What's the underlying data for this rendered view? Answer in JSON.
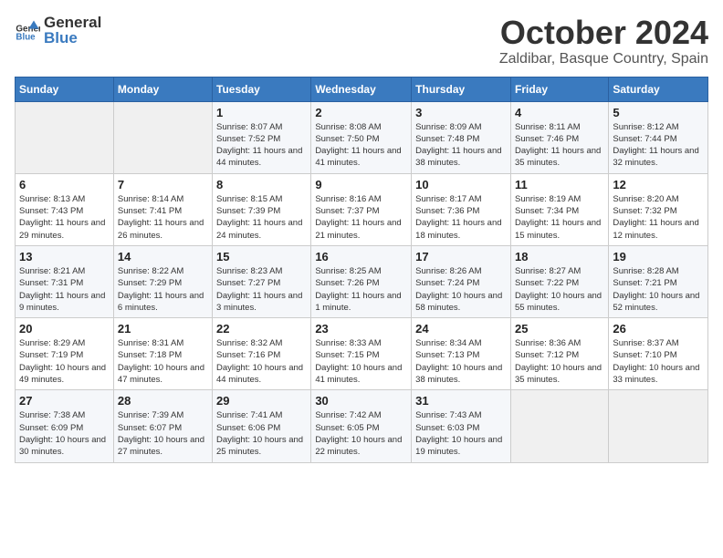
{
  "header": {
    "logo_general": "General",
    "logo_blue": "Blue",
    "month": "October 2024",
    "location": "Zaldibar, Basque Country, Spain"
  },
  "days_of_week": [
    "Sunday",
    "Monday",
    "Tuesday",
    "Wednesday",
    "Thursday",
    "Friday",
    "Saturday"
  ],
  "weeks": [
    [
      {
        "day": "",
        "info": ""
      },
      {
        "day": "",
        "info": ""
      },
      {
        "day": "1",
        "info": "Sunrise: 8:07 AM\nSunset: 7:52 PM\nDaylight: 11 hours and 44 minutes."
      },
      {
        "day": "2",
        "info": "Sunrise: 8:08 AM\nSunset: 7:50 PM\nDaylight: 11 hours and 41 minutes."
      },
      {
        "day": "3",
        "info": "Sunrise: 8:09 AM\nSunset: 7:48 PM\nDaylight: 11 hours and 38 minutes."
      },
      {
        "day": "4",
        "info": "Sunrise: 8:11 AM\nSunset: 7:46 PM\nDaylight: 11 hours and 35 minutes."
      },
      {
        "day": "5",
        "info": "Sunrise: 8:12 AM\nSunset: 7:44 PM\nDaylight: 11 hours and 32 minutes."
      }
    ],
    [
      {
        "day": "6",
        "info": "Sunrise: 8:13 AM\nSunset: 7:43 PM\nDaylight: 11 hours and 29 minutes."
      },
      {
        "day": "7",
        "info": "Sunrise: 8:14 AM\nSunset: 7:41 PM\nDaylight: 11 hours and 26 minutes."
      },
      {
        "day": "8",
        "info": "Sunrise: 8:15 AM\nSunset: 7:39 PM\nDaylight: 11 hours and 24 minutes."
      },
      {
        "day": "9",
        "info": "Sunrise: 8:16 AM\nSunset: 7:37 PM\nDaylight: 11 hours and 21 minutes."
      },
      {
        "day": "10",
        "info": "Sunrise: 8:17 AM\nSunset: 7:36 PM\nDaylight: 11 hours and 18 minutes."
      },
      {
        "day": "11",
        "info": "Sunrise: 8:19 AM\nSunset: 7:34 PM\nDaylight: 11 hours and 15 minutes."
      },
      {
        "day": "12",
        "info": "Sunrise: 8:20 AM\nSunset: 7:32 PM\nDaylight: 11 hours and 12 minutes."
      }
    ],
    [
      {
        "day": "13",
        "info": "Sunrise: 8:21 AM\nSunset: 7:31 PM\nDaylight: 11 hours and 9 minutes."
      },
      {
        "day": "14",
        "info": "Sunrise: 8:22 AM\nSunset: 7:29 PM\nDaylight: 11 hours and 6 minutes."
      },
      {
        "day": "15",
        "info": "Sunrise: 8:23 AM\nSunset: 7:27 PM\nDaylight: 11 hours and 3 minutes."
      },
      {
        "day": "16",
        "info": "Sunrise: 8:25 AM\nSunset: 7:26 PM\nDaylight: 11 hours and 1 minute."
      },
      {
        "day": "17",
        "info": "Sunrise: 8:26 AM\nSunset: 7:24 PM\nDaylight: 10 hours and 58 minutes."
      },
      {
        "day": "18",
        "info": "Sunrise: 8:27 AM\nSunset: 7:22 PM\nDaylight: 10 hours and 55 minutes."
      },
      {
        "day": "19",
        "info": "Sunrise: 8:28 AM\nSunset: 7:21 PM\nDaylight: 10 hours and 52 minutes."
      }
    ],
    [
      {
        "day": "20",
        "info": "Sunrise: 8:29 AM\nSunset: 7:19 PM\nDaylight: 10 hours and 49 minutes."
      },
      {
        "day": "21",
        "info": "Sunrise: 8:31 AM\nSunset: 7:18 PM\nDaylight: 10 hours and 47 minutes."
      },
      {
        "day": "22",
        "info": "Sunrise: 8:32 AM\nSunset: 7:16 PM\nDaylight: 10 hours and 44 minutes."
      },
      {
        "day": "23",
        "info": "Sunrise: 8:33 AM\nSunset: 7:15 PM\nDaylight: 10 hours and 41 minutes."
      },
      {
        "day": "24",
        "info": "Sunrise: 8:34 AM\nSunset: 7:13 PM\nDaylight: 10 hours and 38 minutes."
      },
      {
        "day": "25",
        "info": "Sunrise: 8:36 AM\nSunset: 7:12 PM\nDaylight: 10 hours and 35 minutes."
      },
      {
        "day": "26",
        "info": "Sunrise: 8:37 AM\nSunset: 7:10 PM\nDaylight: 10 hours and 33 minutes."
      }
    ],
    [
      {
        "day": "27",
        "info": "Sunrise: 7:38 AM\nSunset: 6:09 PM\nDaylight: 10 hours and 30 minutes."
      },
      {
        "day": "28",
        "info": "Sunrise: 7:39 AM\nSunset: 6:07 PM\nDaylight: 10 hours and 27 minutes."
      },
      {
        "day": "29",
        "info": "Sunrise: 7:41 AM\nSunset: 6:06 PM\nDaylight: 10 hours and 25 minutes."
      },
      {
        "day": "30",
        "info": "Sunrise: 7:42 AM\nSunset: 6:05 PM\nDaylight: 10 hours and 22 minutes."
      },
      {
        "day": "31",
        "info": "Sunrise: 7:43 AM\nSunset: 6:03 PM\nDaylight: 10 hours and 19 minutes."
      },
      {
        "day": "",
        "info": ""
      },
      {
        "day": "",
        "info": ""
      }
    ]
  ]
}
